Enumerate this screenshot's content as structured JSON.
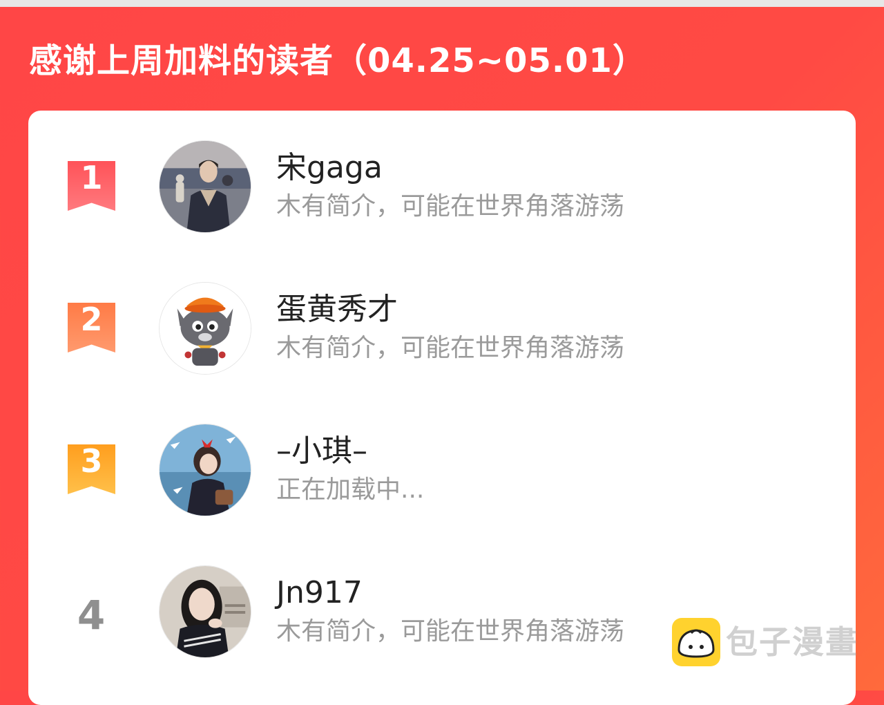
{
  "banner": {
    "title": "感谢上周加料的读者（04.25~05.01）"
  },
  "readers": [
    {
      "rank": "1",
      "name": "宋gaga",
      "bio": "木有简介，可能在世界角落游荡",
      "avatar": "photo-avatar"
    },
    {
      "rank": "2",
      "name": "蛋黄秀才",
      "bio": "木有简介，可能在世界角落游荡",
      "avatar": "cartoon-wolf-avatar"
    },
    {
      "rank": "3",
      "name": "–小琪–",
      "bio": "正在加载中...",
      "avatar": "anime-girl-avatar"
    },
    {
      "rank": "4",
      "name": "Jn917",
      "bio": "木有简介，可能在世界角落游荡",
      "avatar": "photo-avatar"
    }
  ],
  "watermark": {
    "text": "包子漫畫",
    "icon": "bun-icon"
  },
  "colors": {
    "banner": "#ff4646",
    "rank1": "#ff5258",
    "rank2": "#ff7b46",
    "rank3": "#ff9e1e",
    "rank_plain": "#8f8f8f",
    "bio": "#9a9a9a"
  }
}
